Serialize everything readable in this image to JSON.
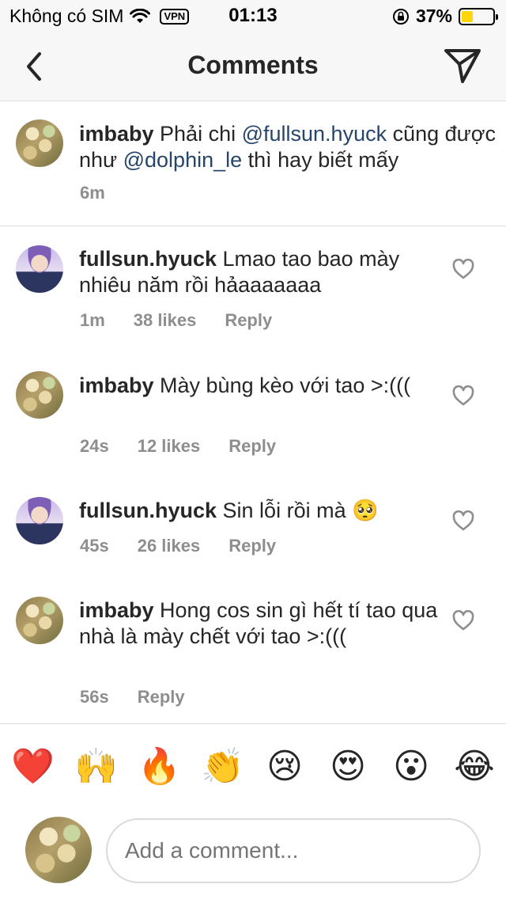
{
  "status_bar": {
    "carrier": "Không có SIM",
    "vpn": "VPN",
    "time": "01:13",
    "battery": "37%",
    "battery_level": 0.37
  },
  "nav": {
    "title": "Comments"
  },
  "caption": {
    "username": "imbaby",
    "text_1": " Phải chi ",
    "mention_1": "@fullsun.hyuck",
    "text_2": " cũng được như ",
    "mention_2": "@dolphin_le",
    "text_3": " thì hay biết mấy",
    "time": "6m"
  },
  "comments": [
    {
      "username": "fullsun.hyuck",
      "text": " Lmao tao bao mày nhiêu năm rồi hảaaaaaaa",
      "time": "1m",
      "likes": "38 likes",
      "reply": "Reply"
    },
    {
      "username": "imbaby",
      "text": " Mày bùng kèo với tao >:(((",
      "time": "24s",
      "likes": "12 likes",
      "reply": "Reply"
    },
    {
      "username": "fullsun.hyuck",
      "text": " Sin lỗi rồi mà 🥺",
      "time": "45s",
      "likes": "26 likes",
      "reply": "Reply"
    },
    {
      "username": "imbaby",
      "text": " Hong cos sin gì hết tí tao qua nhà là mày chết với tao >:(((",
      "time": "56s",
      "reply": "Reply"
    }
  ],
  "emojis": [
    "❤️",
    "🙌",
    "🔥",
    "👏",
    "😢",
    "😍",
    "😮",
    "😂"
  ],
  "composer": {
    "placeholder": "Add a comment..."
  },
  "colors": {
    "mention": "#25456b",
    "meta": "#8e8e8e",
    "battery": "#ffd60a"
  }
}
